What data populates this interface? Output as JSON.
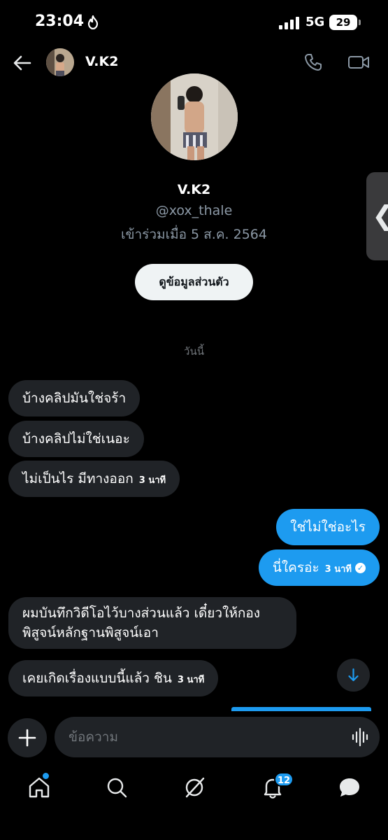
{
  "status_bar": {
    "time": "23:04",
    "network": "5G",
    "battery": "29"
  },
  "header": {
    "name": "V.K2"
  },
  "profile": {
    "name": "V.K2",
    "handle": "@xox_thale",
    "joined": "เข้าร่วมเมื่อ 5 ส.ค. 2564",
    "button_label": "ดูข้อมูลส่วนตัว"
  },
  "date_separator": "วันนี้",
  "messages": [
    {
      "text": "บ้างคลิปมันใช่จร้า",
      "stamp": ""
    },
    {
      "text": "บ้างคลิปไม่ใช่เนอะ",
      "stamp": ""
    },
    {
      "text": "ไม่เป็นไร มีทางออก",
      "stamp": "3 นาที"
    },
    {
      "text": "ใช่ไม่ใช่อะไร",
      "stamp": ""
    },
    {
      "text": "นี่ใครอ่ะ",
      "stamp": "3 นาที"
    },
    {
      "text": "ผมบันทึกวิดีโอไว้บางส่วนแล้ว เดี๋ยวให้กองพิสูจน์หลักฐานพิสูจน์เอา",
      "stamp": ""
    },
    {
      "text": "เคยเกิดเรื่องแบบนี้แล้ว ชิน",
      "stamp": "3 นาที"
    }
  ],
  "composer": {
    "placeholder": "ข้อความ"
  },
  "nav": {
    "notifications_badge": "12"
  },
  "colors": {
    "accent": "#1d9bf0",
    "incoming_bubble": "#202327",
    "background": "#000000"
  }
}
